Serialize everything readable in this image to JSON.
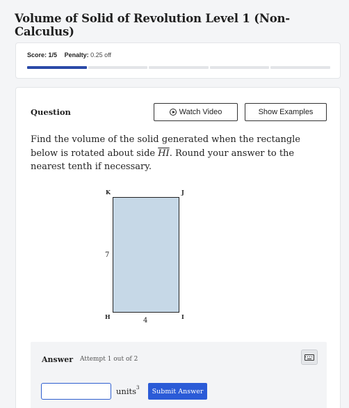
{
  "page": {
    "title": "Volume of Solid of Revolution Level 1 (Non-Calculus)"
  },
  "score": {
    "score_label": "Score:",
    "score_value": "1/5",
    "penalty_label": "Penalty:",
    "penalty_value": "0.25 off",
    "progress_segments": 5,
    "progress_filled": 1
  },
  "question": {
    "heading": "Question",
    "watch_video_label": "Watch Video",
    "show_examples_label": "Show Examples",
    "text_before": "Find the volume of the solid generated when the rectangle below is rotated about side ",
    "segment": "HI",
    "text_after": ". Round your answer to the nearest tenth if necessary."
  },
  "figure": {
    "vertices": {
      "top_left": "K",
      "top_right": "J",
      "bottom_left": "H",
      "bottom_right": "I"
    },
    "side_length_label": "7",
    "bottom_length_label": "4",
    "fill_color": "#c6d8e7"
  },
  "answer": {
    "heading": "Answer",
    "attempt_text": "Attempt 1 out of 2",
    "input_value": "",
    "units_label": "units",
    "units_exponent": "3",
    "submit_label": "Submit Answer",
    "keyboard_icon": "keyboard-icon"
  },
  "colors": {
    "accent": "#2b5bd7",
    "progress": "#2b4aa8"
  }
}
